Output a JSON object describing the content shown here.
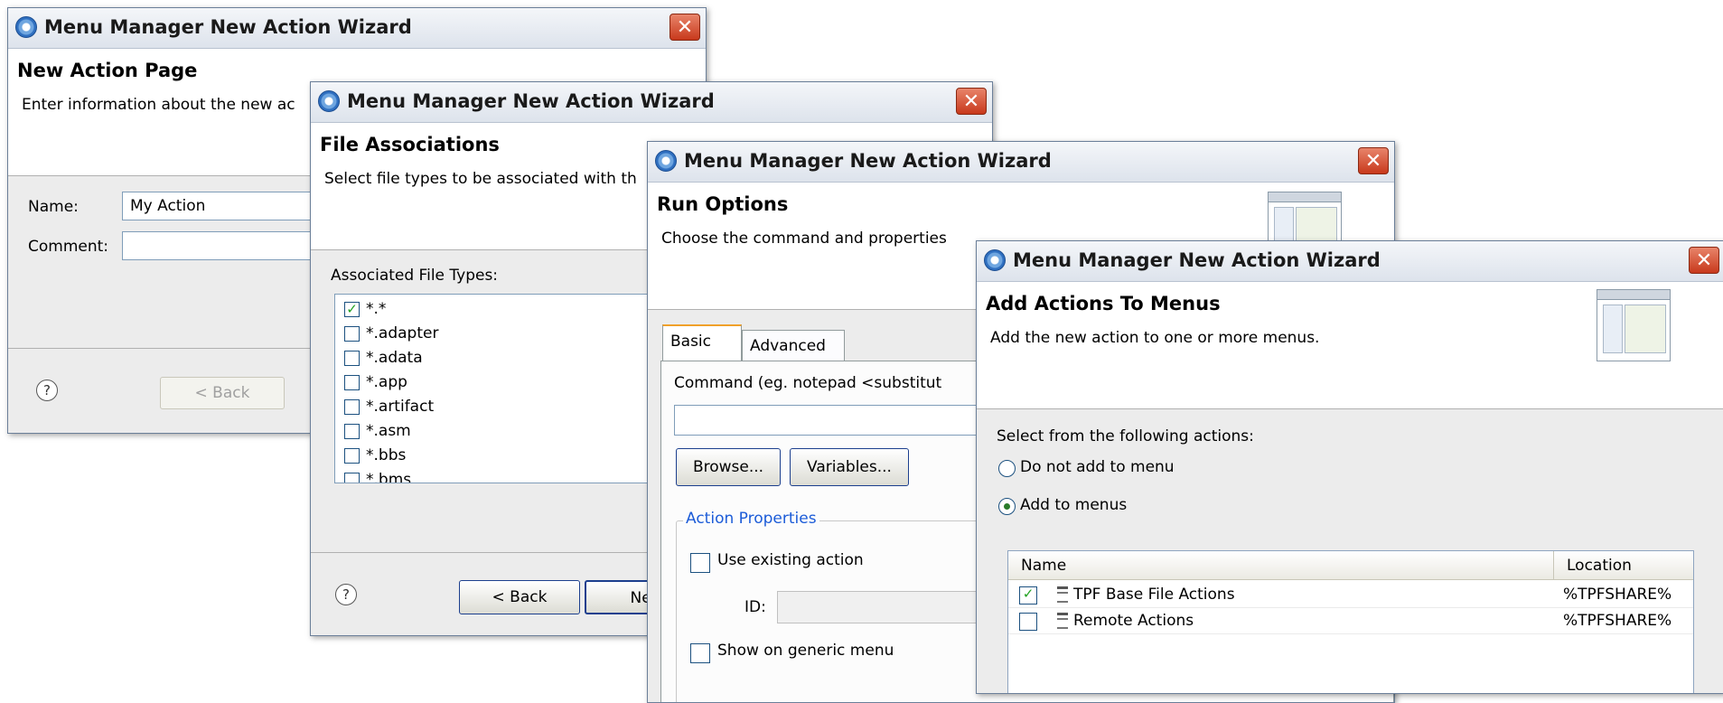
{
  "window_title": "Menu Manager New Action Wizard",
  "close_glyph": "✕",
  "help_glyph": "?",
  "w1": {
    "page_title": "New Action Page",
    "description": "Enter information about the new ac",
    "name_label": "Name:",
    "name_value": "My Action",
    "comment_label": "Comment:",
    "comment_value": "",
    "back_label": "< Back"
  },
  "w2": {
    "page_title": "File Associations",
    "description": "Select file types to be associated with th",
    "list_label": "Associated File Types:",
    "file_types": [
      {
        "ext": "*.*",
        "checked": true
      },
      {
        "ext": "*.adapter",
        "checked": false
      },
      {
        "ext": "*.adata",
        "checked": false
      },
      {
        "ext": "*.app",
        "checked": false
      },
      {
        "ext": "*.artifact",
        "checked": false
      },
      {
        "ext": "*.asm",
        "checked": false
      },
      {
        "ext": "*.bbs",
        "checked": false
      },
      {
        "ext": "*.bms",
        "checked": false
      }
    ],
    "back_label": "< Back",
    "next_label": "Nex"
  },
  "w3": {
    "page_title": "Run Options",
    "description": "Choose the command and properties",
    "tabs": [
      "Basic",
      "Advanced"
    ],
    "command_label": "Command (eg. notepad <substitut",
    "command_value": "",
    "browse_label": "Browse...",
    "variables_label": "Variables...",
    "group_title": "Action Properties",
    "use_existing_label": "Use existing action",
    "id_label": "ID:",
    "show_generic_label": "Show on generic menu"
  },
  "w4": {
    "page_title": "Add Actions To Menus",
    "description": "Add the new action to one or more menus.",
    "select_label": "Select from the following actions:",
    "radio_no": "Do not add to menu",
    "radio_add": "Add to menus",
    "col_name": "Name",
    "col_location": "Location",
    "rows": [
      {
        "name": "TPF Base File Actions",
        "location": "%TPFSHARE%",
        "checked": true
      },
      {
        "name": "Remote Actions",
        "location": "%TPFSHARE%",
        "checked": false
      }
    ]
  },
  "colors": {
    "close_red": "#c8391c",
    "group_title_blue": "#1c5cd8",
    "check_green": "#21a121"
  }
}
